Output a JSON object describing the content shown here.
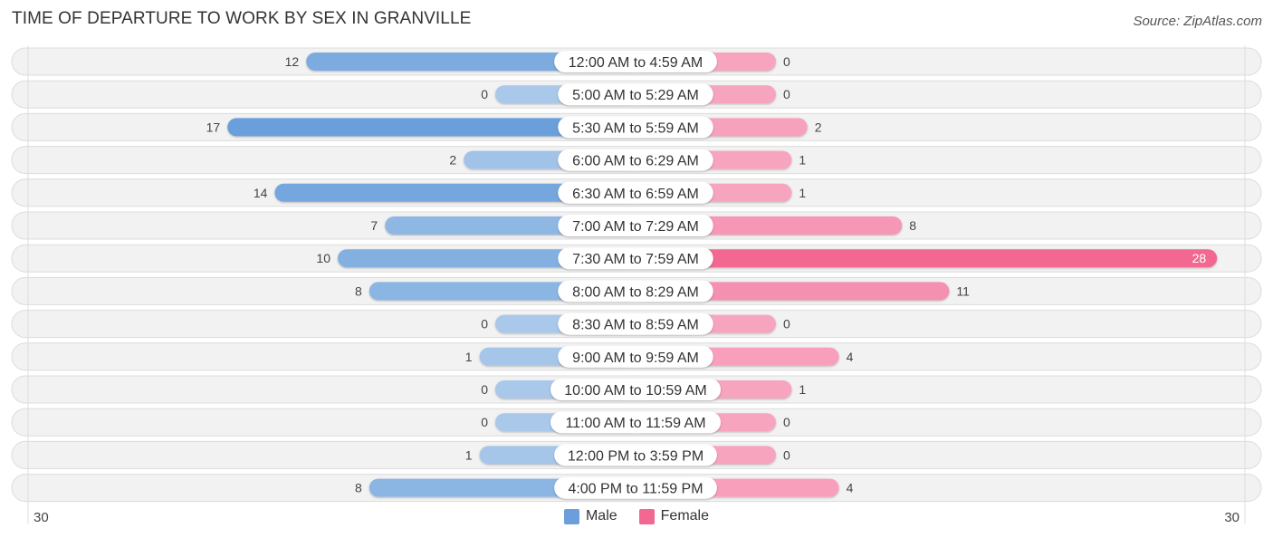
{
  "title": "TIME OF DEPARTURE TO WORK BY SEX IN GRANVILLE",
  "source": "Source: ZipAtlas.com",
  "colors": {
    "male": "#6a9fdb",
    "male_light": "#a9c8ea",
    "female": "#f26891",
    "female_light": "#f7a5bf",
    "row_bg": "#f2f2f2"
  },
  "chart_data": {
    "type": "bar",
    "orientation": "horizontal-diverging",
    "title": "TIME OF DEPARTURE TO WORK BY SEX IN GRANVILLE",
    "categories": [
      "12:00 AM to 4:59 AM",
      "5:00 AM to 5:29 AM",
      "5:30 AM to 5:59 AM",
      "6:00 AM to 6:29 AM",
      "6:30 AM to 6:59 AM",
      "7:00 AM to 7:29 AM",
      "7:30 AM to 7:59 AM",
      "8:00 AM to 8:29 AM",
      "8:30 AM to 8:59 AM",
      "9:00 AM to 9:59 AM",
      "10:00 AM to 10:59 AM",
      "11:00 AM to 11:59 AM",
      "12:00 PM to 3:59 PM",
      "4:00 PM to 11:59 PM"
    ],
    "series": [
      {
        "name": "Male",
        "values": [
          12,
          0,
          17,
          2,
          14,
          7,
          10,
          8,
          0,
          1,
          0,
          0,
          1,
          8
        ]
      },
      {
        "name": "Female",
        "values": [
          0,
          0,
          2,
          1,
          1,
          8,
          28,
          11,
          0,
          4,
          1,
          0,
          0,
          4
        ]
      }
    ],
    "axis": {
      "left_label": "30",
      "right_label": "30",
      "max": 30
    },
    "legend": {
      "position": "bottom-center",
      "entries": [
        "Male",
        "Female"
      ]
    },
    "xlabel": "",
    "ylabel": ""
  }
}
